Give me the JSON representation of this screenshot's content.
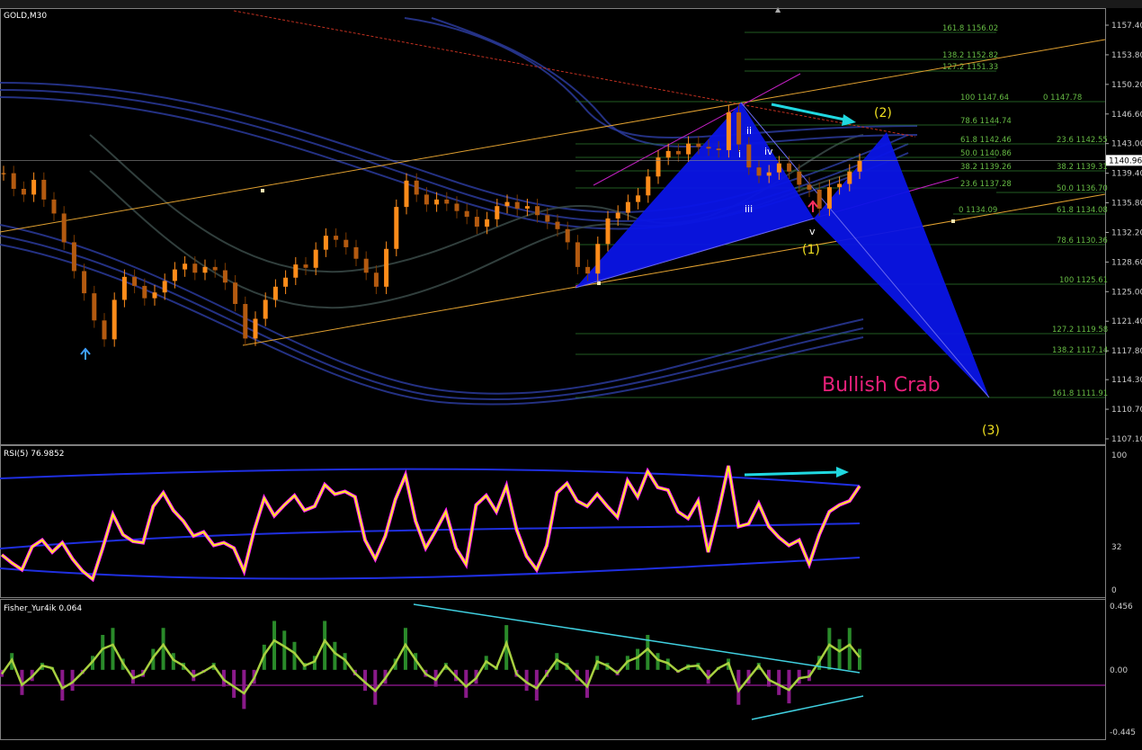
{
  "toolbar": {
    "scroll_marker": "▲"
  },
  "chart_data": [
    {
      "type": "candlestick",
      "title": "GOLD,M30",
      "ylim": [
        1107.1,
        1158.6
      ],
      "y_ticks": [
        "1157.40",
        "1153.80",
        "1150.20",
        "1146.60",
        "1143.00",
        "1139.40",
        "1135.80",
        "1132.20",
        "1128.60",
        "1125.00",
        "1121.40",
        "1117.80",
        "1114.30",
        "1110.70",
        "1107.10"
      ],
      "current_price": "1140.96",
      "price_series": [
        1139.4,
        1137.5,
        1136.8,
        1138.6,
        1136.2,
        1134.5,
        1131.0,
        1127.5,
        1124.8,
        1121.5,
        1119.2,
        1124.0,
        1126.8,
        1125.7,
        1124.2,
        1124.9,
        1126.3,
        1127.7,
        1128.4,
        1127.3,
        1128.0,
        1127.6,
        1126.1,
        1123.5,
        1119.3,
        1121.7,
        1124.0,
        1125.6,
        1126.7,
        1128.3,
        1127.9,
        1130.1,
        1131.8,
        1131.3,
        1130.4,
        1129.0,
        1127.3,
        1125.6,
        1130.2,
        1135.3,
        1138.5,
        1136.8,
        1135.6,
        1136.2,
        1135.7,
        1134.8,
        1134.1,
        1132.9,
        1133.8,
        1135.4,
        1135.9,
        1135.1,
        1135.4,
        1134.3,
        1133.5,
        1132.6,
        1131.0,
        1128.0,
        1127.2,
        1130.8,
        1133.9,
        1134.6,
        1135.9,
        1136.7,
        1139.0,
        1141.3,
        1142.1,
        1141.7,
        1143.0,
        1142.6,
        1142.4,
        1142.2,
        1146.8,
        1142.9,
        1140.1,
        1139.1,
        1139.5,
        1140.6,
        1139.6,
        1138.0,
        1137.4,
        1135.1,
        1137.7,
        1138.1,
        1139.6,
        1140.9
      ],
      "fib_levels": [
        {
          "label": "161.8 1156.02"
        },
        {
          "label": "138.2 1152.82"
        },
        {
          "label": "127.2 1151.33"
        },
        {
          "label": "100 1147.64"
        },
        {
          "label": "0 1147.78"
        },
        {
          "label": "78.6 1144.74"
        },
        {
          "label": "61.8 1142.46"
        },
        {
          "label": "23.6 1142.55"
        },
        {
          "label": "50.0 1140.86"
        },
        {
          "label": "38.2 1139.26"
        },
        {
          "label": "38.2 1139.31"
        },
        {
          "label": "23.6 1137.28"
        },
        {
          "label": "50.0 1136.70"
        },
        {
          "label": "0 1134.09"
        },
        {
          "label": "61.8 1134.08"
        },
        {
          "label": "78.6 1130.36"
        },
        {
          "label": "100 1125.61"
        },
        {
          "label": "127.2 1119.58"
        },
        {
          "label": "138.2 1117.14"
        },
        {
          "label": "161.8 1111.91"
        }
      ],
      "annotations": {
        "pattern_label": "Bullish Crab",
        "wave_1": "(1)",
        "wave_2": "(2)",
        "wave_3": "(3)",
        "sub_i": "i",
        "sub_ii": "ii",
        "sub_iii": "iii",
        "sub_iv": "iv",
        "sub_v": "v"
      },
      "colors": {
        "background": "#000000",
        "bull_candle": "#ff8c1a",
        "bear_candle": "#7a3a00",
        "pattern_fill": "#0a14e6",
        "pattern_text": "#e8207a",
        "wave_label": "#f0e020",
        "fib_line": "#2e7d2e",
        "fib_text": "#66bb44",
        "channel": "#e0a030",
        "band_blue": "#2a3a9a",
        "band_gray": "#3a4a48",
        "arrow": "#20d8e0"
      }
    },
    {
      "type": "line",
      "title": "RSI(5) 76.9852",
      "ylim": [
        0,
        100
      ],
      "y_ticks": [
        "100",
        "32",
        "0"
      ],
      "series": [
        {
          "values": [
            26,
            20,
            15,
            32,
            37,
            28,
            35,
            23,
            14,
            8,
            31,
            56,
            41,
            36,
            35,
            62,
            72,
            59,
            51,
            40,
            43,
            33,
            35,
            31,
            14,
            44,
            68,
            55,
            63,
            70,
            59,
            62,
            78,
            71,
            73,
            69,
            37,
            23,
            40,
            67,
            85,
            51,
            31,
            44,
            58,
            31,
            19,
            63,
            70,
            58,
            77,
            45,
            25,
            15,
            33,
            72,
            79,
            66,
            62,
            71,
            62,
            54,
            81,
            69,
            88,
            76,
            74,
            58,
            53,
            66,
            28,
            58,
            92,
            47,
            49,
            64,
            47,
            39,
            33,
            37,
            19,
            41,
            58,
            63,
            66,
            77
          ]
        }
      ],
      "annotation_arrow": true
    },
    {
      "type": "bar",
      "title": "Fisher_Yur4ik 0.064",
      "ylim": [
        -0.445,
        0.456
      ],
      "y_ticks": [
        "0.456",
        "0.00",
        "-0.445"
      ],
      "values": [
        -0.05,
        0.12,
        -0.18,
        -0.08,
        0.05,
        0.02,
        -0.22,
        -0.15,
        -0.03,
        0.1,
        0.25,
        0.3,
        0.08,
        -0.1,
        -0.05,
        0.15,
        0.3,
        0.12,
        0.05,
        -0.08,
        -0.02,
        0.05,
        -0.12,
        -0.2,
        -0.28,
        -0.1,
        0.18,
        0.35,
        0.28,
        0.2,
        0.05,
        0.1,
        0.35,
        0.2,
        0.12,
        -0.04,
        -0.15,
        -0.25,
        -0.1,
        0.08,
        0.3,
        0.12,
        -0.05,
        -0.12,
        0.05,
        -0.08,
        -0.2,
        -0.1,
        0.1,
        0.02,
        0.32,
        -0.05,
        -0.15,
        -0.22,
        -0.05,
        0.12,
        0.05,
        -0.08,
        -0.2,
        0.1,
        0.05,
        -0.04,
        0.1,
        0.15,
        0.25,
        0.12,
        0.08,
        -0.02,
        0.04,
        0.05,
        -0.1,
        0.02,
        0.08,
        -0.25,
        -0.1,
        0.05,
        -0.12,
        -0.18,
        -0.24,
        -0.1,
        -0.08,
        0.1,
        0.3,
        0.22,
        0.3,
        0.15
      ]
    }
  ]
}
